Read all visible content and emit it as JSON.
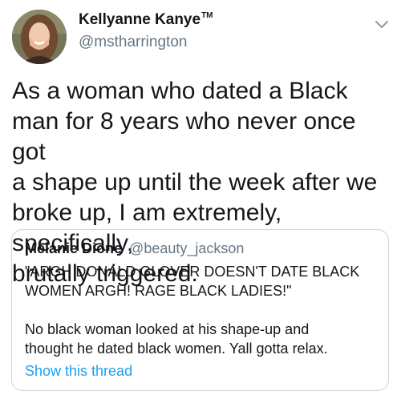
{
  "author": {
    "display_name": "Kellyanne Kanye",
    "trademark": "TM",
    "handle": "@mstharrington"
  },
  "tweet": {
    "text": "As a woman who dated a Black\nman for 8 years who never once got\na shape up until the week after we\nbroke up, I am extremely, specifically,\nbrutally triggered."
  },
  "quoted_tweet": {
    "display_name": "Melanie Dione",
    "handle": "@beauty_jackson",
    "text": "\"ARGH DONALD GLOVER DOESN'T DATE BLACK\nWOMEN ARGH! RAGE BLACK LADIES!\"\n\nNo black woman looked at his shape-up and\nthought he dated black women. Yall gotta relax.",
    "link_label": "Show this thread"
  },
  "colors": {
    "text": "#14171a",
    "secondary": "#657786",
    "link": "#1da1f2",
    "border": "#ccd6dd"
  },
  "icons": {
    "avatar": "profile-photo",
    "menu": "chevron-down-icon"
  }
}
